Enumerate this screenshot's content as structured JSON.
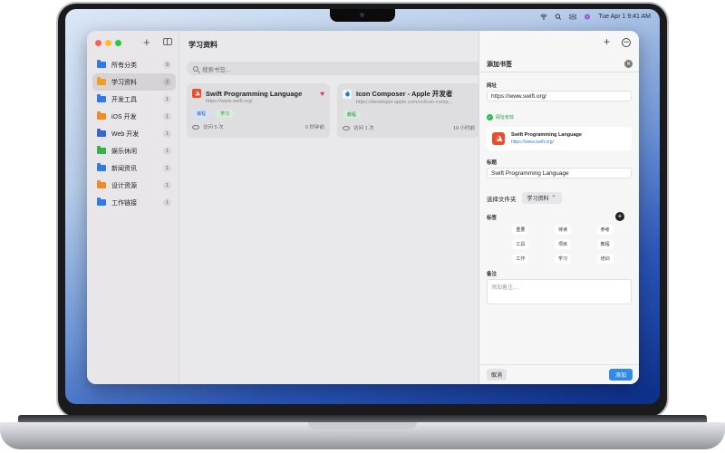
{
  "menubar": {
    "datetime": "Tue Apr 1  9:41 AM"
  },
  "sidebar": {
    "items": [
      {
        "label": "所有分类",
        "count": "9",
        "color": "#2f7ae6"
      },
      {
        "label": "学习资料",
        "count": "2",
        "color": "#f0a020"
      },
      {
        "label": "开发工具",
        "count": "1",
        "color": "#2f7ae6"
      },
      {
        "label": "iOS 开发",
        "count": "1",
        "color": "#f08a24"
      },
      {
        "label": "Web 开发",
        "count": "1",
        "color": "#3a62d8"
      },
      {
        "label": "娱乐休闲",
        "count": "1",
        "color": "#34b24a"
      },
      {
        "label": "新闻资讯",
        "count": "1",
        "color": "#2f7ae6"
      },
      {
        "label": "设计资源",
        "count": "1",
        "color": "#f08a24"
      },
      {
        "label": "工作链接",
        "count": "1",
        "color": "#2f7ae6"
      }
    ],
    "active_index": 1
  },
  "main": {
    "title": "学习资料",
    "search_placeholder": "搜索书签...",
    "cards": [
      {
        "title": "Swift Programming Language",
        "url": "https://www.swift.org/",
        "icon": "swift-icon",
        "favorite": true,
        "tags": [
          {
            "label": "编程",
            "bg": "#d6e3f5",
            "fg": "#2f6ac0"
          },
          {
            "label": "学习",
            "bg": "#d8ecd9",
            "fg": "#2d8a47"
          }
        ],
        "visits": "访问 5 次",
        "time": "0 秒钟前"
      },
      {
        "title": "Icon Composer - Apple 开发者",
        "url": "https://developer.apple.com/cn/icon-comp...",
        "icon": "apple-icon",
        "favorite": false,
        "tags": [
          {
            "label": "教程",
            "bg": "#d8ecd9",
            "fg": "#2d8a47"
          }
        ],
        "visits": "访问 1 次",
        "time": "19 小时前"
      }
    ]
  },
  "sheet": {
    "title": "添加书签",
    "url_label": "网址",
    "url_value": "https://www.swift.org/",
    "valid_text": "网址有效",
    "preview_title": "Swift Programming Language",
    "preview_url": "https://www.swift.org/",
    "name_label": "标题",
    "name_value": "Swift Programming Language",
    "folder_label": "选择文件夹",
    "folder_value": "学习资料",
    "tags_label": "标签",
    "tags": [
      "重要",
      "待读",
      "参考",
      "工具",
      "项目",
      "教程",
      "工作",
      "学习",
      "培训"
    ],
    "notes_label": "备注",
    "notes_placeholder": "添加备注...",
    "cancel_label": "取消",
    "add_label": "添加"
  }
}
